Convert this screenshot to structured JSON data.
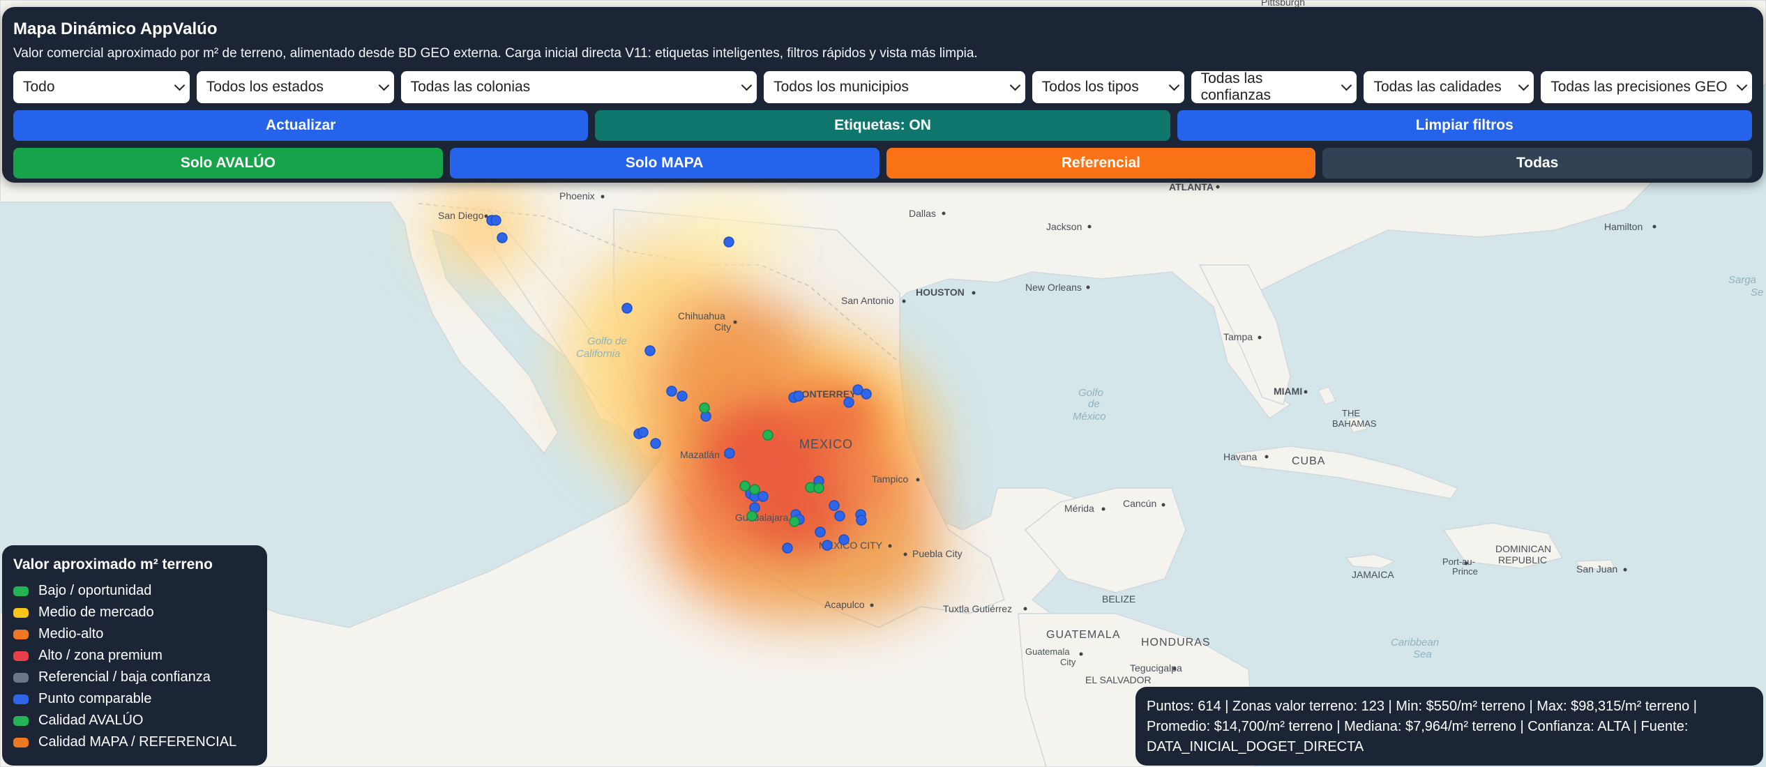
{
  "header": {
    "title": "Mapa Dinámico AppValúo",
    "subtitle": "Valor comercial aproximado por m² de terreno, alimentado desde BD GEO externa. Carga inicial directa V11: etiquetas inteligentes, filtros rápidos y vista más limpia."
  },
  "filters": [
    {
      "value": "Todo"
    },
    {
      "value": "Todos los estados"
    },
    {
      "value": "Todas las colonias"
    },
    {
      "value": "Todos los municipios"
    },
    {
      "value": "Todos los tipos"
    },
    {
      "value": "Todas las confianzas"
    },
    {
      "value": "Todas las calidades"
    },
    {
      "value": "Todas las precisiones GEO"
    }
  ],
  "actions": {
    "refresh": "Actualizar",
    "labels_toggle": "Etiquetas: ON",
    "clear_filters": "Limpiar filtros"
  },
  "quick": {
    "solo_avaluo": "Solo AVALÚO",
    "solo_mapa": "Solo MAPA",
    "referencial": "Referencial",
    "todas": "Todas"
  },
  "legend": {
    "title": "Valor aproximado m² terreno",
    "items": [
      {
        "label": "Bajo / oportunidad",
        "color": "#22b455"
      },
      {
        "label": "Medio de mercado",
        "color": "#f5c518"
      },
      {
        "label": "Medio-alto",
        "color": "#f07822"
      },
      {
        "label": "Alto / zona premium",
        "color": "#e8414a"
      },
      {
        "label": "Referencial / baja confianza",
        "color": "#6b7689"
      },
      {
        "label": "Punto comparable",
        "color": "#2f66e8"
      },
      {
        "label": "Calidad AVALÚO",
        "color": "#22b455"
      },
      {
        "label": "Calidad MAPA / REFERENCIAL",
        "color": "#f07822"
      }
    ]
  },
  "stats": {
    "line1": "Puntos: 614 | Zonas valor terreno: 123 | Min: $550/m² terreno | Max: $98,315/m² terreno |",
    "line2": "Promedio: $14,700/m² terreno | Mediana: $7,964/m² terreno | Confianza: ALTA | Fuente:",
    "line3": "DATA_INICIAL_DOGET_DIRECTA"
  },
  "map_labels": {
    "pittsburgh": "Pittsburgh",
    "phoenix": "Phoenix",
    "san_diego": "San Diego",
    "dallas": "Dallas",
    "jackson": "Jackson",
    "atlanta": "ATLANTA",
    "hamilton": "Hamilton",
    "sargasso_1": "Sarga",
    "sargasso_2": "Se",
    "chihuahua_1": "Chihuahua",
    "chihuahua_2": "City",
    "san_antonio": "San Antonio",
    "houston": "HOUSTON",
    "new_orleans": "New Orleans",
    "tampa": "Tampa",
    "gulf_cal_1": "Golfo de",
    "gulf_cal_2": "California",
    "monterrey": "MONTERREY",
    "golfo_1": "Golfo",
    "golfo_2": "de",
    "golfo_3": "México",
    "miami": "MIAMI",
    "bahamas_1": "THE",
    "bahamas_2": "BAHAMAS",
    "mexico": "MEXICO",
    "mazatlan": "Mazatlán",
    "havana": "Havana",
    "cuba": "CUBA",
    "tampico": "Tampico",
    "merida": "Mérida",
    "cancun": "Cancún",
    "guadalajara": "Guadalajara",
    "mexico_city": "MEXICO CITY",
    "puebla": "Puebla City",
    "dominican_1": "DOMINICAN",
    "dominican_2": "REPUBLIC",
    "port_au_1": "Port-au-",
    "port_au_2": "Prince",
    "san_juan": "San Juan",
    "jamaica": "JAMAICA",
    "belize": "BELIZE",
    "tuxtla": "Tuxtla Gutiérrez",
    "acapulco": "Acapulco",
    "caribbean_1": "Caribbean",
    "caribbean_2": "Sea",
    "guatemala": "GUATEMALA",
    "guatemala_city_1": "Guatemala",
    "guatemala_city_2": "City",
    "honduras": "HONDURAS",
    "tegucigalpa": "Tegucigalpa",
    "el_salvador": "EL SALVADOR"
  },
  "points": {
    "comparable_color": "#2f66e8",
    "avaluo_color": "#22b455"
  }
}
